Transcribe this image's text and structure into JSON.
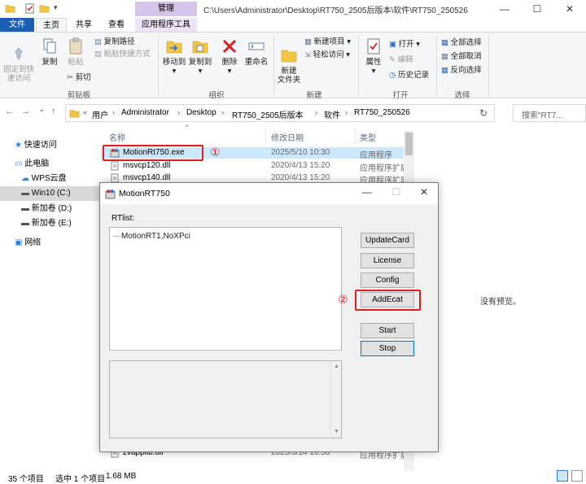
{
  "window": {
    "ctx_group": "管理",
    "path": "C:\\Users\\Administrator\\Desktop\\RT750_2505后版本\\软件\\RT750_250526",
    "min": "—",
    "max": "☐",
    "close": "✕"
  },
  "tabs": {
    "file": "文件",
    "home": "主页",
    "share": "共享",
    "view": "查看",
    "app_tools": "应用程序工具"
  },
  "ribbon": {
    "pin": "固定到快\n速访问",
    "copy": "复制",
    "paste": "粘贴",
    "copy_path": "复制路径",
    "paste_shortcut": "粘贴快捷方式",
    "cut": "剪切",
    "group_clipboard": "剪贴板",
    "move_to": "移动到",
    "copy_to": "复制到",
    "delete": "删除",
    "rename": "重命名",
    "group_organize": "组织",
    "new_folder": "新建\n文件夹",
    "new_item": "新建项目",
    "easy_access": "轻松访问",
    "group_new": "新建",
    "properties": "属性",
    "open": "打开",
    "edit": "编辑",
    "history": "历史记录",
    "group_open": "打开",
    "select_all": "全部选择",
    "select_none": "全部取消",
    "invert": "反向选择",
    "group_select": "选择"
  },
  "nav": {
    "back": "←",
    "forward": "→",
    "history_down": "⌄",
    "up": "↑"
  },
  "address": {
    "lead": "«",
    "crumbs": [
      "用户",
      "Administrator",
      "Desktop",
      "RT750_2505后版本",
      "软件",
      "RT750_250526"
    ],
    "refresh": "↻",
    "search_placeholder": "搜索\"RT7..."
  },
  "sidebar": {
    "quick_access": "快速访问",
    "this_pc": "此电脑",
    "wps": "WPS云盘",
    "c": "Win10 (C:)",
    "d": "新加卷 (D:)",
    "e": "新加卷 (E:)",
    "network": "网络"
  },
  "columns": {
    "name": "名称",
    "date": "修改日期",
    "type": "类型"
  },
  "files": [
    {
      "name": "MotionRt750.exe",
      "date": "2025/5/10 10:30",
      "type": "应用程序"
    },
    {
      "name": "msvcp120.dll",
      "date": "2020/4/13 15:20",
      "type": "应用程序扩展"
    },
    {
      "name": "msvcp140.dll",
      "date": "2020/4/13 15:20",
      "type": "应用程序扩展"
    },
    {
      "name": "zvapplib.dll",
      "date": "2025/3/14 16:58",
      "type": "应用程序扩展"
    }
  ],
  "annotations": {
    "one": "①",
    "two": "②"
  },
  "preview": "没有预览。",
  "status": {
    "count": "35 个项目",
    "selected": "选中 1 个项目",
    "size": "1.68 MB"
  },
  "dialog": {
    "title": "MotionRT750",
    "rtlist_label": "RTlist:",
    "tree_item": "MotionRT1,NoXPci",
    "buttons": {
      "updatecard": "UpdateCard",
      "license": "License",
      "config": "Config",
      "addecat": "AddEcat",
      "start": "Start",
      "stop": "Stop"
    },
    "min": "—",
    "max": "☐",
    "close": "✕"
  },
  "colors": {
    "annotation": "#e21c1c",
    "file_tab": "#1a5fb4",
    "selection": "#cce8ff",
    "ctx_tab": "#d4c4ea"
  }
}
